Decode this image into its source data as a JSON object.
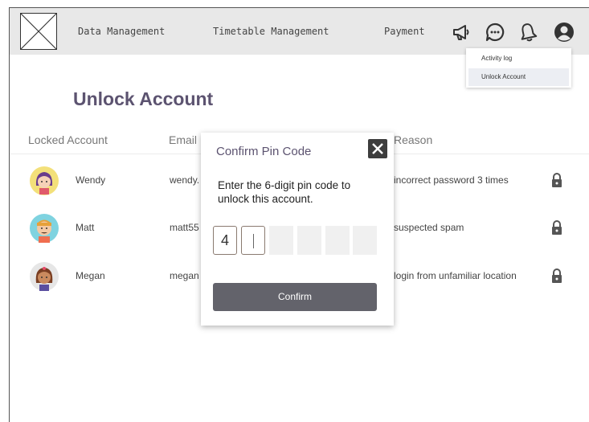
{
  "nav": {
    "items": [
      "Data Management",
      "Timetable Management",
      "Payment"
    ],
    "icons": [
      "megaphone-icon",
      "chat-icon",
      "bell-icon",
      "user-icon"
    ]
  },
  "dropdown": {
    "items": [
      {
        "label": "Activity log",
        "selected": false
      },
      {
        "label": "Unlock Account",
        "selected": true
      }
    ]
  },
  "page": {
    "title": "Unlock Account"
  },
  "table": {
    "headers": [
      "Locked Account",
      "Email",
      "Reason"
    ],
    "rows": [
      {
        "name": "Wendy",
        "email": "wendy.",
        "reason": "incorrect password 3 times",
        "avatar": "girl-avatar"
      },
      {
        "name": "Matt",
        "email": "matt55",
        "reason": "suspected spam",
        "avatar": "boy-avatar"
      },
      {
        "name": "Megan",
        "email": "megan",
        "reason": "login from unfamiliar location",
        "avatar": "girl-avatar-2"
      }
    ]
  },
  "modal": {
    "title": "Confirm Pin Code",
    "message": "Enter the 6-digit pin code to unlock this account.",
    "pins": [
      "4",
      "",
      "",
      "",
      "",
      ""
    ],
    "active_pin_index": 1,
    "confirm_label": "Confirm"
  },
  "colors": {
    "topbar": "#e8e8e8",
    "title": "#5c5370",
    "button": "#63636b",
    "close": "#3d3d3d"
  }
}
